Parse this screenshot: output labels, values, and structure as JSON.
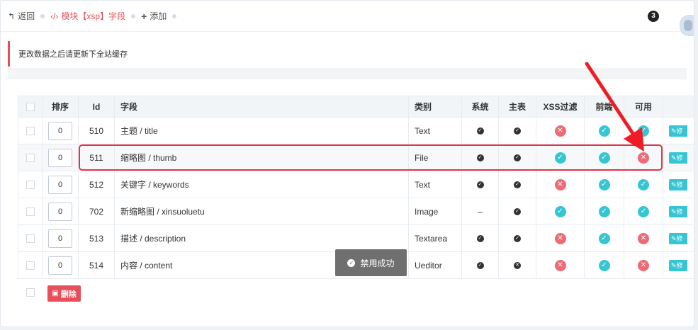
{
  "toolbar": {
    "back_label": "返回",
    "module_label": "模块【xsp】字段",
    "add_label": "添加",
    "notification_count": "3"
  },
  "note": "更改数据之后请更新下全站缓存",
  "table": {
    "headers": [
      "排序",
      "Id",
      "字段",
      "类别",
      "系统",
      "主表",
      "XSS过滤",
      "前端",
      "可用"
    ],
    "rows": [
      {
        "sort": "0",
        "id": "510",
        "field": "主题 / title",
        "type": "Text",
        "system": "check",
        "main": "check",
        "xss": "no",
        "front": "ok",
        "enabled": "ok",
        "edit": "修"
      },
      {
        "sort": "0",
        "id": "511",
        "field": "缩略图 / thumb",
        "type": "File",
        "system": "check",
        "main": "check",
        "xss": "ok",
        "front": "ok",
        "enabled": "no",
        "edit": "修"
      },
      {
        "sort": "0",
        "id": "512",
        "field": "关键字 / keywords",
        "type": "Text",
        "system": "check",
        "main": "check",
        "xss": "no",
        "front": "ok",
        "enabled": "ok",
        "edit": "修"
      },
      {
        "sort": "0",
        "id": "702",
        "field": "新缩略图 / xinsuoluetu",
        "type": "Image",
        "system": "–",
        "main": "check",
        "xss": "ok",
        "front": "ok",
        "enabled": "ok",
        "edit": "修"
      },
      {
        "sort": "0",
        "id": "513",
        "field": "描述 / description",
        "type": "Textarea",
        "system": "check",
        "main": "check",
        "xss": "no",
        "front": "ok",
        "enabled": "no",
        "edit": "修"
      },
      {
        "sort": "0",
        "id": "514",
        "field": "内容 / content",
        "type": "Ueditor",
        "system": "check",
        "main": "cross",
        "xss": "no",
        "front": "ok",
        "enabled": "no",
        "edit": "修"
      }
    ]
  },
  "delete_label": "删除",
  "toast": "禁用成功",
  "colors": {
    "accent": "#e7505a",
    "ok": "#36c6d3",
    "no": "#ed6b75",
    "annotation": "#e5344a"
  }
}
